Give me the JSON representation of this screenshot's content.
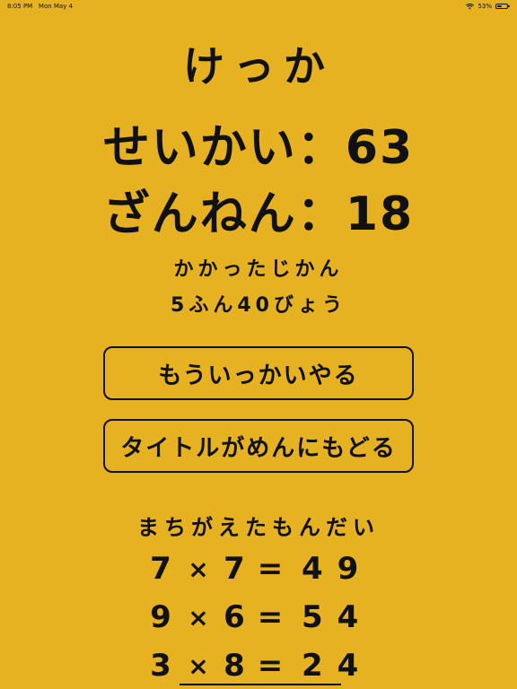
{
  "status": {
    "time": "8:05 PM",
    "date": "Mon May 4",
    "battery": "53%",
    "battery_level": 0.53,
    "icons": [
      "wifi-icon",
      "battery-icon"
    ]
  },
  "title": "けっか",
  "score": {
    "correct_label": "せいかい",
    "correct_value": "63",
    "wrong_label": "ざんねん",
    "wrong_value": "18",
    "separator": "："
  },
  "time": {
    "label": "かかったじかん",
    "value": "5ふん40びょう"
  },
  "buttons": {
    "retry": "もういっかいやる",
    "back_to_title": "タイトルがめんにもどる"
  },
  "mistakes": {
    "header": "まちがえたもんだい",
    "items": [
      {
        "a": "7",
        "op": "×",
        "b": "7",
        "eq": "=",
        "answer": "49"
      },
      {
        "a": "9",
        "op": "×",
        "b": "6",
        "eq": "=",
        "answer": "54"
      },
      {
        "a": "3",
        "op": "×",
        "b": "8",
        "eq": "=",
        "answer": "24"
      }
    ]
  },
  "colors": {
    "background": "#E6B222",
    "text": "#111111"
  }
}
